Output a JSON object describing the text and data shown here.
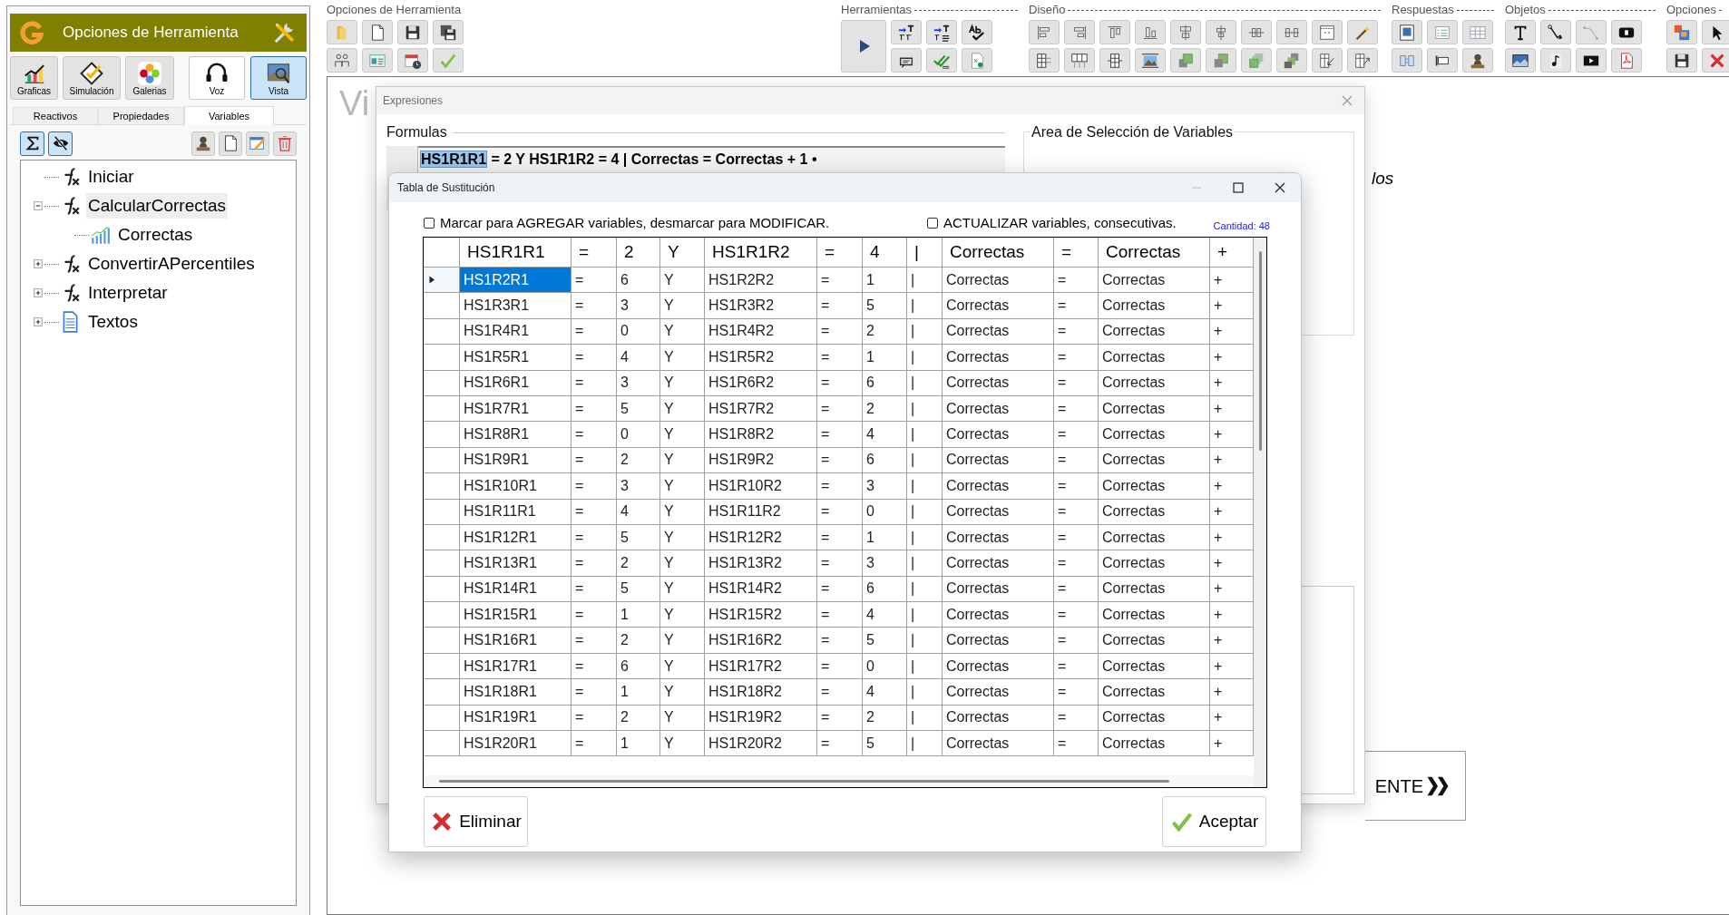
{
  "sidebar": {
    "title": "Opciones de Herramienta",
    "mode_buttons": [
      {
        "label": "Graficas",
        "selected": false
      },
      {
        "label": "Simulación",
        "selected": false
      },
      {
        "label": "Galerias",
        "selected": false
      },
      {
        "label": "Voz",
        "selected": false
      },
      {
        "label": "Vista",
        "selected": true
      }
    ],
    "tabs": [
      {
        "label": "Reactivos",
        "selected": false
      },
      {
        "label": "Propiedades",
        "selected": false
      },
      {
        "label": "Variables",
        "selected": true
      }
    ],
    "toggles": [
      {
        "on": true
      },
      {
        "on": true
      }
    ],
    "tree": [
      {
        "label": "Iniciar",
        "kind": "function",
        "selected": false
      },
      {
        "label": "CalcularCorrectas",
        "kind": "function",
        "selected": true,
        "expanded": true,
        "children": [
          {
            "label": "Correctas",
            "kind": "variable",
            "selected": false
          }
        ]
      },
      {
        "label": "ConvertirAPercentiles",
        "kind": "function",
        "selected": false,
        "expanded": false
      },
      {
        "label": "Interpretar",
        "kind": "function",
        "selected": false,
        "expanded": false
      },
      {
        "label": "Textos",
        "kind": "text",
        "selected": false,
        "expanded": false
      }
    ]
  },
  "toolbar": {
    "groups": [
      {
        "label": "Opciones de Herramienta"
      },
      {
        "label": "Herramientas"
      },
      {
        "label": "Diseño"
      },
      {
        "label": "Respuestas"
      },
      {
        "label": "Objetos"
      },
      {
        "label": "Opciones"
      }
    ]
  },
  "canvas": {
    "title": "Vi",
    "italic_text": "los",
    "next_button": "ENTE"
  },
  "expressions_dialog": {
    "title": "Expresiones",
    "formulas_label": "Formulas",
    "formula_selection": "HS1R1R1",
    "formula_rest": " = 2 Y HS1R1R2 = 4 | Correctas = Correctas + 1 •",
    "variables_area_label": "Area de Selección de Variables"
  },
  "substitution_dialog": {
    "title": "Tabla de Sustitución",
    "checkboxes": [
      {
        "label": "Marcar para AGREGAR variables, desmarcar para MODIFICAR.",
        "checked": false
      },
      {
        "label": "ACTUALIZAR variables, consecutivas.",
        "checked": false
      }
    ],
    "count": "Cantidad: 48",
    "grid": {
      "columns": [
        "HS1R1R1",
        "=",
        "2",
        "Y",
        "HS1R1R2",
        "=",
        "4",
        "|",
        "Correctas",
        "=",
        "Correctas",
        "+"
      ],
      "rows": [
        {
          "selected": true,
          "cells": [
            "HS1R2R1",
            "=",
            "6",
            "Y",
            "HS1R2R2",
            "=",
            "1",
            "|",
            "Correctas",
            "=",
            "Correctas",
            "+"
          ]
        },
        {
          "selected": false,
          "cells": [
            "HS1R3R1",
            "=",
            "3",
            "Y",
            "HS1R3R2",
            "=",
            "5",
            "|",
            "Correctas",
            "=",
            "Correctas",
            "+"
          ]
        },
        {
          "selected": false,
          "cells": [
            "HS1R4R1",
            "=",
            "0",
            "Y",
            "HS1R4R2",
            "=",
            "2",
            "|",
            "Correctas",
            "=",
            "Correctas",
            "+"
          ]
        },
        {
          "selected": false,
          "cells": [
            "HS1R5R1",
            "=",
            "4",
            "Y",
            "HS1R5R2",
            "=",
            "1",
            "|",
            "Correctas",
            "=",
            "Correctas",
            "+"
          ]
        },
        {
          "selected": false,
          "cells": [
            "HS1R6R1",
            "=",
            "3",
            "Y",
            "HS1R6R2",
            "=",
            "6",
            "|",
            "Correctas",
            "=",
            "Correctas",
            "+"
          ]
        },
        {
          "selected": false,
          "cells": [
            "HS1R7R1",
            "=",
            "5",
            "Y",
            "HS1R7R2",
            "=",
            "2",
            "|",
            "Correctas",
            "=",
            "Correctas",
            "+"
          ]
        },
        {
          "selected": false,
          "cells": [
            "HS1R8R1",
            "=",
            "0",
            "Y",
            "HS1R8R2",
            "=",
            "4",
            "|",
            "Correctas",
            "=",
            "Correctas",
            "+"
          ]
        },
        {
          "selected": false,
          "cells": [
            "HS1R9R1",
            "=",
            "2",
            "Y",
            "HS1R9R2",
            "=",
            "6",
            "|",
            "Correctas",
            "=",
            "Correctas",
            "+"
          ]
        },
        {
          "selected": false,
          "cells": [
            "HS1R10R1",
            "=",
            "3",
            "Y",
            "HS1R10R2",
            "=",
            "3",
            "|",
            "Correctas",
            "=",
            "Correctas",
            "+"
          ]
        },
        {
          "selected": false,
          "cells": [
            "HS1R11R1",
            "=",
            "4",
            "Y",
            "HS1R11R2",
            "=",
            "0",
            "|",
            "Correctas",
            "=",
            "Correctas",
            "+"
          ]
        },
        {
          "selected": false,
          "cells": [
            "HS1R12R1",
            "=",
            "5",
            "Y",
            "HS1R12R2",
            "=",
            "1",
            "|",
            "Correctas",
            "=",
            "Correctas",
            "+"
          ]
        },
        {
          "selected": false,
          "cells": [
            "HS1R13R1",
            "=",
            "2",
            "Y",
            "HS1R13R2",
            "=",
            "3",
            "|",
            "Correctas",
            "=",
            "Correctas",
            "+"
          ]
        },
        {
          "selected": false,
          "cells": [
            "HS1R14R1",
            "=",
            "5",
            "Y",
            "HS1R14R2",
            "=",
            "6",
            "|",
            "Correctas",
            "=",
            "Correctas",
            "+"
          ]
        },
        {
          "selected": false,
          "cells": [
            "HS1R15R1",
            "=",
            "1",
            "Y",
            "HS1R15R2",
            "=",
            "4",
            "|",
            "Correctas",
            "=",
            "Correctas",
            "+"
          ]
        },
        {
          "selected": false,
          "cells": [
            "HS1R16R1",
            "=",
            "2",
            "Y",
            "HS1R16R2",
            "=",
            "5",
            "|",
            "Correctas",
            "=",
            "Correctas",
            "+"
          ]
        },
        {
          "selected": false,
          "cells": [
            "HS1R17R1",
            "=",
            "6",
            "Y",
            "HS1R17R2",
            "=",
            "0",
            "|",
            "Correctas",
            "=",
            "Correctas",
            "+"
          ]
        },
        {
          "selected": false,
          "cells": [
            "HS1R18R1",
            "=",
            "1",
            "Y",
            "HS1R18R2",
            "=",
            "4",
            "|",
            "Correctas",
            "=",
            "Correctas",
            "+"
          ]
        },
        {
          "selected": false,
          "cells": [
            "HS1R19R1",
            "=",
            "2",
            "Y",
            "HS1R19R2",
            "=",
            "2",
            "|",
            "Correctas",
            "=",
            "Correctas",
            "+"
          ]
        },
        {
          "selected": false,
          "cells": [
            "HS1R20R1",
            "=",
            "1",
            "Y",
            "HS1R20R2",
            "=",
            "5",
            "|",
            "Correctas",
            "=",
            "Correctas",
            "+"
          ]
        }
      ]
    },
    "buttons": [
      "Eliminar",
      "Aceptar"
    ]
  }
}
